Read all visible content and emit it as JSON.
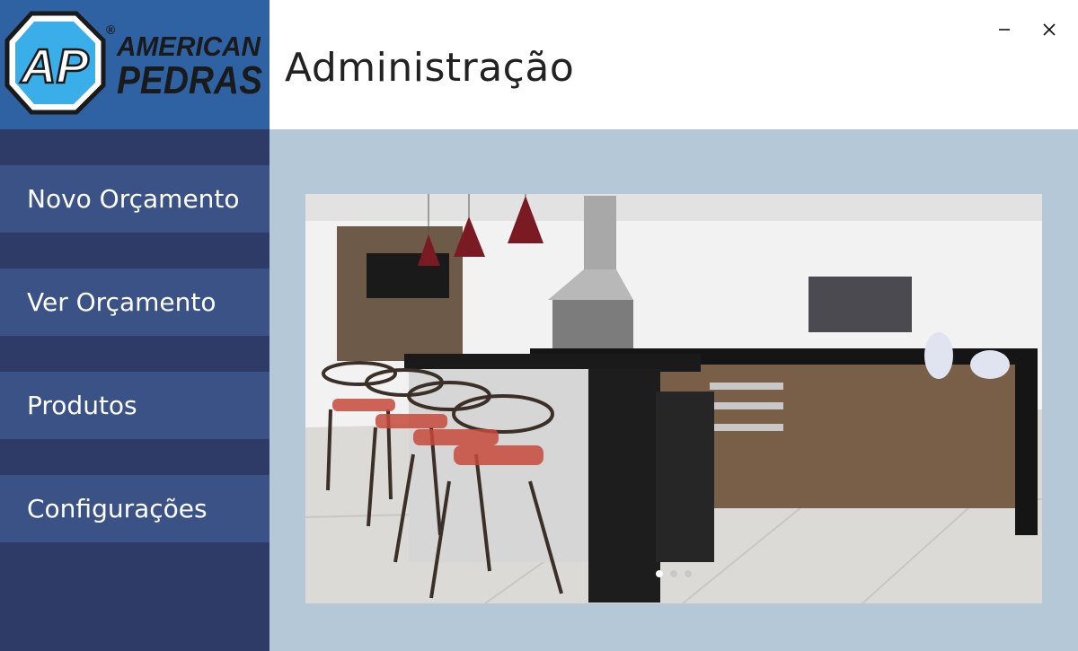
{
  "brand": {
    "logo_mark": "AP",
    "logo_word1": "AMERICAN",
    "logo_word2": "PEDRAS",
    "registered": "®",
    "primary_color": "#2e62a3",
    "sidebar_color": "#2e3b66",
    "nav_item_color": "#3a5285",
    "content_bg": "#b4c8d8"
  },
  "header": {
    "title": "Administração"
  },
  "window_controls": {
    "minimize_icon": "minimize-icon",
    "close_icon": "close-icon"
  },
  "sidebar": {
    "items": [
      {
        "label": "Novo Orçamento"
      },
      {
        "label": "Ver Orçamento"
      },
      {
        "label": "Produtos"
      },
      {
        "label": "Configurações"
      }
    ]
  },
  "carousel": {
    "slide_count": 3,
    "active_index": 0,
    "image_description_icon": "kitchen-photo"
  }
}
